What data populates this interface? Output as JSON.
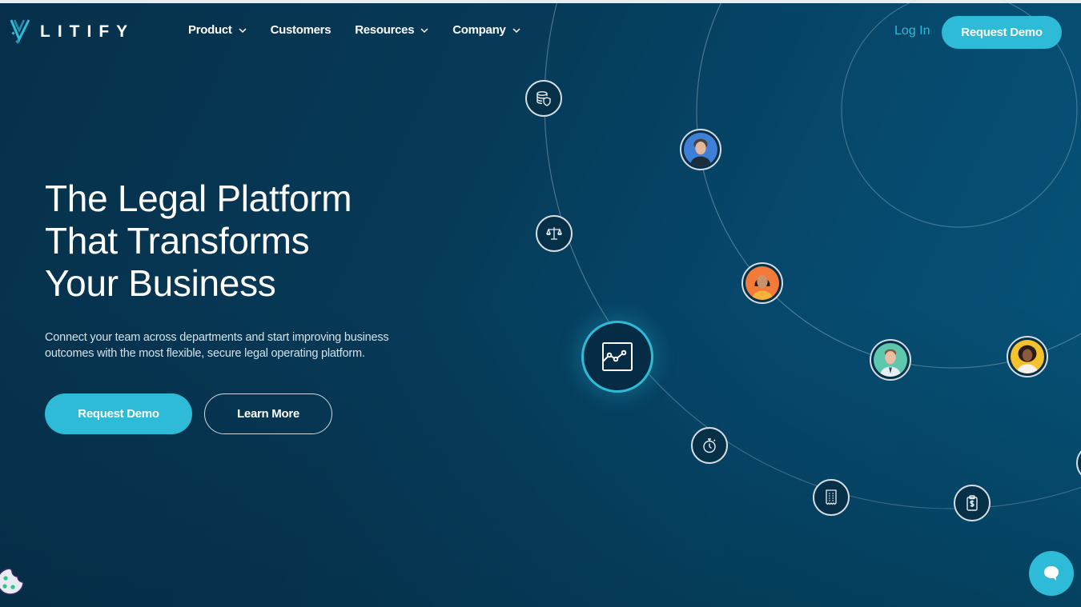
{
  "brand": {
    "name": "LITIFY",
    "accent_color": "#2dbbd7",
    "background_color": "#063a58"
  },
  "nav": {
    "items": [
      {
        "label": "Product",
        "has_dropdown": true
      },
      {
        "label": "Customers",
        "has_dropdown": false
      },
      {
        "label": "Resources",
        "has_dropdown": true
      },
      {
        "label": "Company",
        "has_dropdown": true
      }
    ],
    "login_label": "Log In",
    "cta_label": "Request Demo"
  },
  "hero": {
    "title_lines": [
      "The Legal Platform",
      "That Transforms",
      "Your Business"
    ],
    "subtitle": "Connect your team across departments and start improving business outcomes with the most flexible, secure legal operating platform.",
    "primary_button": "Request Demo",
    "secondary_button": "Learn More"
  },
  "graphic": {
    "icon_nodes": [
      "database-shield-icon",
      "scales-icon",
      "analytics-chart-icon",
      "stopwatch-icon",
      "receipt-icon",
      "clipboard-dollar-icon"
    ],
    "avatars": [
      {
        "name": "avatar-woman-blue",
        "bg": "#3f7fd6"
      },
      {
        "name": "avatar-woman-orange",
        "bg": "#f47a3a"
      },
      {
        "name": "avatar-man-teal",
        "bg": "#5ec8ae"
      },
      {
        "name": "avatar-woman-yellow",
        "bg": "#f5c22c"
      }
    ]
  },
  "widgets": {
    "chat_icon": "chat-bubble-icon",
    "cookie_icon": "cookie-icon"
  }
}
